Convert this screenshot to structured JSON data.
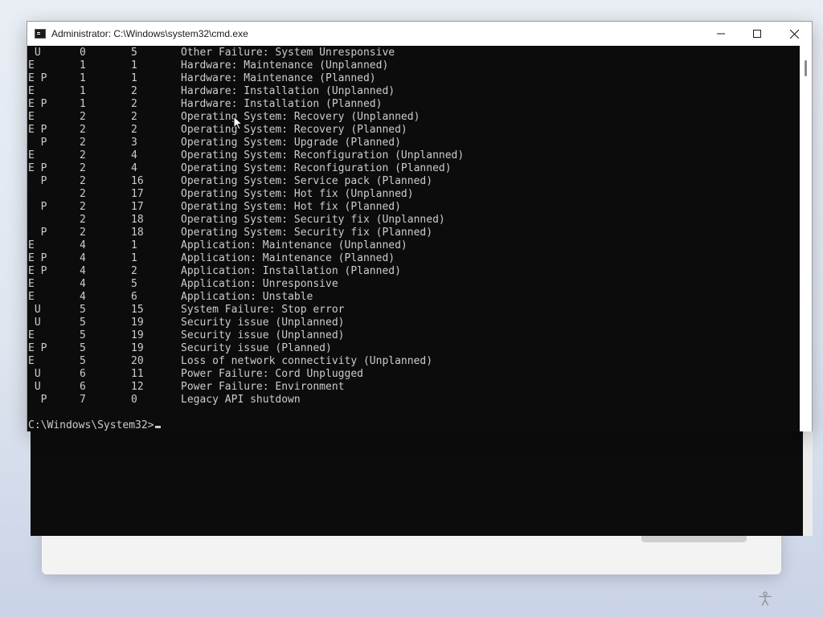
{
  "window": {
    "title": "Administrator: C:\\Windows\\system32\\cmd.exe",
    "icon": "cmd-icon"
  },
  "console": {
    "rows": [
      {
        "flags": " U",
        "major": "0",
        "minor": "5",
        "description": "Other Failure: System Unresponsive"
      },
      {
        "flags": "E",
        "major": "1",
        "minor": "1",
        "description": "Hardware: Maintenance (Unplanned)"
      },
      {
        "flags": "E P",
        "major": "1",
        "minor": "1",
        "description": "Hardware: Maintenance (Planned)"
      },
      {
        "flags": "E",
        "major": "1",
        "minor": "2",
        "description": "Hardware: Installation (Unplanned)"
      },
      {
        "flags": "E P",
        "major": "1",
        "minor": "2",
        "description": "Hardware: Installation (Planned)"
      },
      {
        "flags": "E",
        "major": "2",
        "minor": "2",
        "description": "Operating System: Recovery (Unplanned)"
      },
      {
        "flags": "E P",
        "major": "2",
        "minor": "2",
        "description": "Operating System: Recovery (Planned)"
      },
      {
        "flags": "  P",
        "major": "2",
        "minor": "3",
        "description": "Operating System: Upgrade (Planned)"
      },
      {
        "flags": "E",
        "major": "2",
        "minor": "4",
        "description": "Operating System: Reconfiguration (Unplanned)"
      },
      {
        "flags": "E P",
        "major": "2",
        "minor": "4",
        "description": "Operating System: Reconfiguration (Planned)"
      },
      {
        "flags": "  P",
        "major": "2",
        "minor": "16",
        "description": "Operating System: Service pack (Planned)"
      },
      {
        "flags": "",
        "major": "2",
        "minor": "17",
        "description": "Operating System: Hot fix (Unplanned)"
      },
      {
        "flags": "  P",
        "major": "2",
        "minor": "17",
        "description": "Operating System: Hot fix (Planned)"
      },
      {
        "flags": "",
        "major": "2",
        "minor": "18",
        "description": "Operating System: Security fix (Unplanned)"
      },
      {
        "flags": "  P",
        "major": "2",
        "minor": "18",
        "description": "Operating System: Security fix (Planned)"
      },
      {
        "flags": "E",
        "major": "4",
        "minor": "1",
        "description": "Application: Maintenance (Unplanned)"
      },
      {
        "flags": "E P",
        "major": "4",
        "minor": "1",
        "description": "Application: Maintenance (Planned)"
      },
      {
        "flags": "E P",
        "major": "4",
        "minor": "2",
        "description": "Application: Installation (Planned)"
      },
      {
        "flags": "E",
        "major": "4",
        "minor": "5",
        "description": "Application: Unresponsive"
      },
      {
        "flags": "E",
        "major": "4",
        "minor": "6",
        "description": "Application: Unstable"
      },
      {
        "flags": " U",
        "major": "5",
        "minor": "15",
        "description": "System Failure: Stop error"
      },
      {
        "flags": " U",
        "major": "5",
        "minor": "19",
        "description": "Security issue (Unplanned)"
      },
      {
        "flags": "E",
        "major": "5",
        "minor": "19",
        "description": "Security issue (Unplanned)"
      },
      {
        "flags": "E P",
        "major": "5",
        "minor": "19",
        "description": "Security issue (Planned)"
      },
      {
        "flags": "E",
        "major": "5",
        "minor": "20",
        "description": "Loss of network connectivity (Unplanned)"
      },
      {
        "flags": " U",
        "major": "6",
        "minor": "11",
        "description": "Power Failure: Cord Unplugged"
      },
      {
        "flags": " U",
        "major": "6",
        "minor": "12",
        "description": "Power Failure: Environment"
      },
      {
        "flags": "  P",
        "major": "7",
        "minor": "0",
        "description": "Legacy API shutdown"
      }
    ],
    "prompt": "C:\\Windows\\System32>"
  },
  "colors": {
    "console_bg": "#0c0c0c",
    "console_text": "#cccccc",
    "titlebar_bg": "#ffffff"
  }
}
